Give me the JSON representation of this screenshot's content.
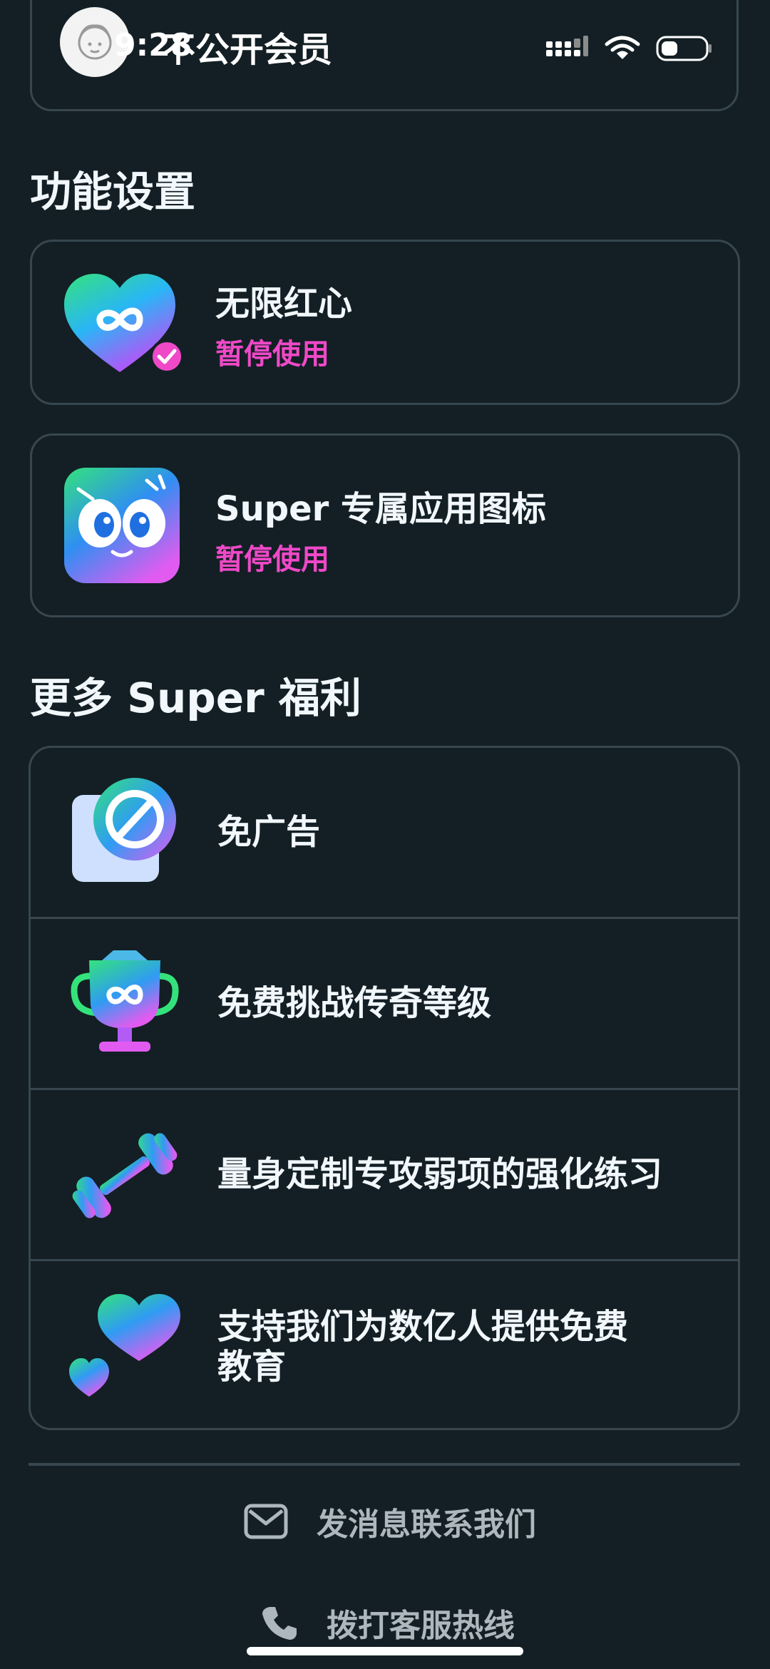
{
  "status_bar": {
    "time": "9:28"
  },
  "top_card": {
    "label": "不公开会员"
  },
  "feature_settings": {
    "title": "功能设置",
    "items": [
      {
        "title": "无限红心",
        "status": "暂停使用"
      },
      {
        "title": "Super 专属应用图标",
        "status": "暂停使用"
      }
    ]
  },
  "more_perks": {
    "title": "更多 Super 福利",
    "items": [
      {
        "label": "免广告"
      },
      {
        "label": "免费挑战传奇等级"
      },
      {
        "label": "量身定制专攻弱项的强化练习"
      },
      {
        "label_line1": "支持我们为数亿人提供免费",
        "label_line2": "教育"
      }
    ]
  },
  "contact": {
    "message_label": "发消息联系我们",
    "hotline_label": "拨打客服热线"
  },
  "colors": {
    "background": "#131f24",
    "border": "#37464f",
    "accent_pink": "#ef49c8",
    "muted_text": "#aeb7bd"
  }
}
